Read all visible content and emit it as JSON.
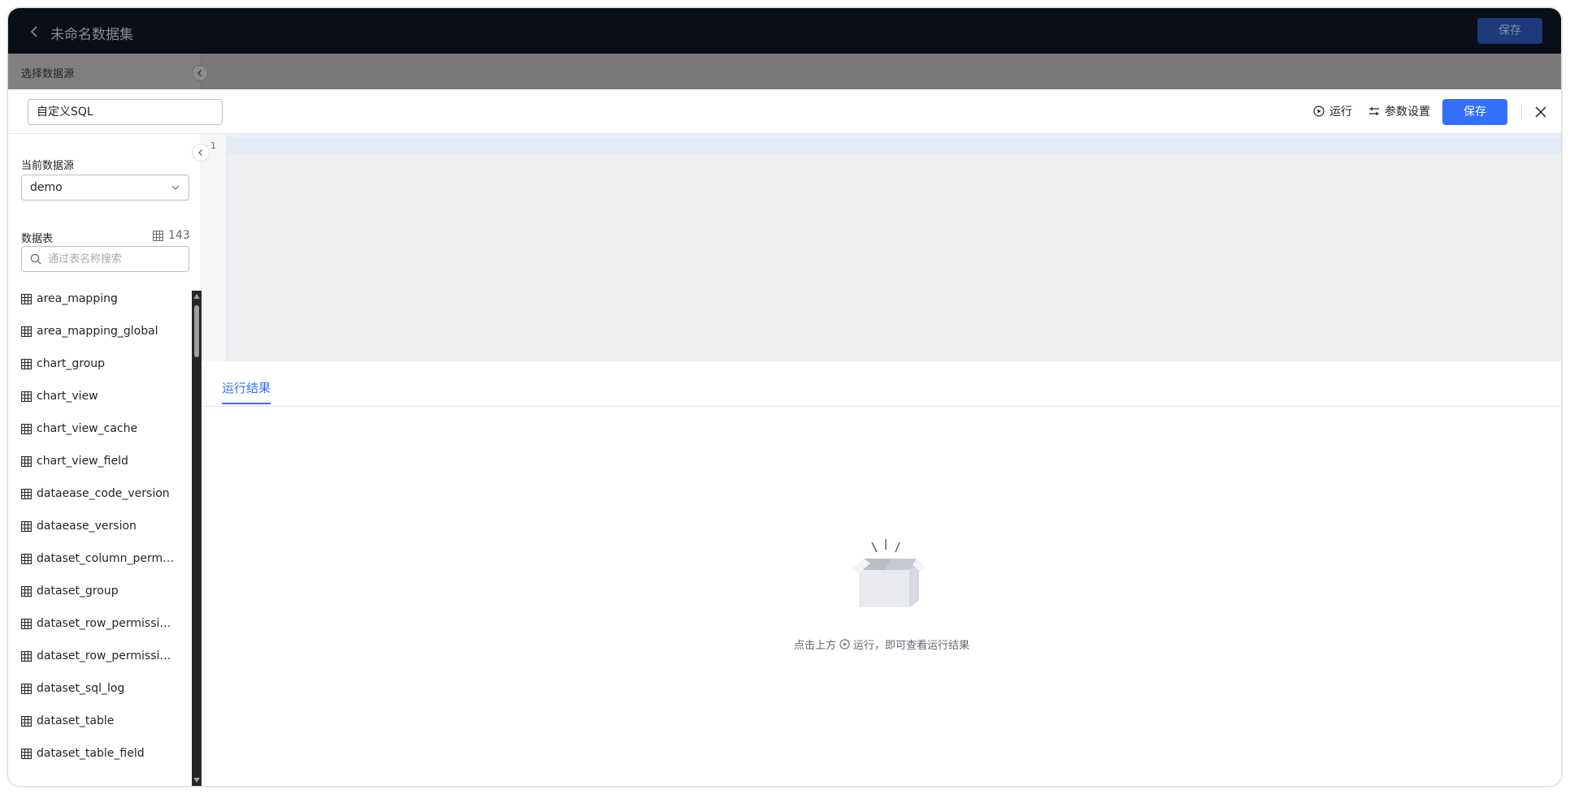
{
  "header": {
    "title": "未命名数据集",
    "save_label": "保存"
  },
  "overlay": {
    "select_source_label": "选择数据源"
  },
  "toolbar": {
    "name_value": "自定义SQL",
    "run_label": "运行",
    "params_label": "参数设置",
    "save_label": "保存"
  },
  "sidebar": {
    "current_source_label": "当前数据源",
    "source_value": "demo",
    "tables_label": "数据表",
    "tables_count": "143",
    "search_placeholder": "通过表名称搜索",
    "tables": [
      "area_mapping",
      "area_mapping_global",
      "chart_group",
      "chart_view",
      "chart_view_cache",
      "chart_view_field",
      "dataease_code_version",
      "dataease_version",
      "dataset_column_permis...",
      "dataset_group",
      "dataset_row_permissions",
      "dataset_row_permission...",
      "dataset_sql_log",
      "dataset_table",
      "dataset_table_field"
    ]
  },
  "editor": {
    "line_number": "1"
  },
  "results": {
    "tab_label": "运行结果",
    "empty_prefix": "点击上方",
    "empty_suffix": "运行，即可查看运行结果"
  },
  "colors": {
    "primary": "#3370ff",
    "topbar": "#0a0e17",
    "overlay": "#7b7b7b"
  }
}
